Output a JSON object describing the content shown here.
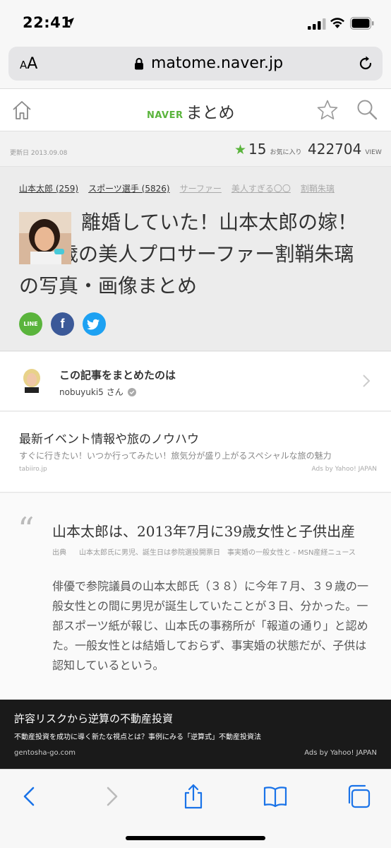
{
  "status_bar": {
    "time": "22:41"
  },
  "browser": {
    "aa_label_small": "A",
    "aa_label_big": "A",
    "url": "matome.naver.jp"
  },
  "site_header": {
    "brand_small": "NAVER",
    "brand_main": "まとめ"
  },
  "meta": {
    "updated": "更新日 2013.09.08",
    "favorite_count": "15",
    "favorite_label": "お気に入り",
    "views": "422704",
    "views_label": "VIEW"
  },
  "article_header": {
    "tags": [
      {
        "label": "山本太郎 (259)"
      },
      {
        "label": "スポーツ選手 (5826)"
      },
      {
        "label": "サーファー"
      },
      {
        "label": "美人すぎる〇〇"
      },
      {
        "label": "割鞘朱璃"
      }
    ],
    "title": "離婚していた！山本太郎の嫁！１９歳の美人プロサーファー割鞘朱璃の写真・画像まとめ",
    "share": {
      "line_label": "LINE",
      "fb_label": "f"
    }
  },
  "curator": {
    "heading": "この記事をまとめたのは",
    "name": "nobuyuki5",
    "suffix": "さん"
  },
  "ad_top": {
    "title": "最新イベント情報や旅のノウハウ",
    "description": "すぐに行きたい！いつか行ってみたい！旅気分が盛り上がるスペシャルな旅の魅力",
    "domain": "tabiiro.jp",
    "by": "Ads by Yahoo! JAPAN"
  },
  "article": {
    "quote_mark": "“",
    "heading": "山本太郎は、2013年7月に39歳女性と子供出産",
    "source_label": "出典",
    "source_text": "山本太郎氏に男児、誕生日は参院選投開票日　事実婚の一般女性と - MSN産経ニュース",
    "body": "俳優で参院議員の山本太郎氏（３８）に今年７月、３９歳の一般女性との間に男児が誕生していたことが３日、分かった。一部スポーツ紙が報じ、山本氏の事務所が「報道の通り」と認めた。一般女性とは結婚しておらず、事実婚の状態だが、子供は認知しているという。"
  },
  "ad_bottom": {
    "title": "許容リスクから逆算の不動産投資",
    "description": "不動産投資を成功に導く新たな視点とは？事例にみる「逆算式」不動産投資法",
    "domain": "gentosha-go.com",
    "by": "Ads by Yahoo! JAPAN"
  },
  "colors": {
    "accent_green": "#5ab43c",
    "ios_blue": "#1a73e8",
    "facebook": "#3b5998",
    "twitter": "#1da1f2"
  }
}
